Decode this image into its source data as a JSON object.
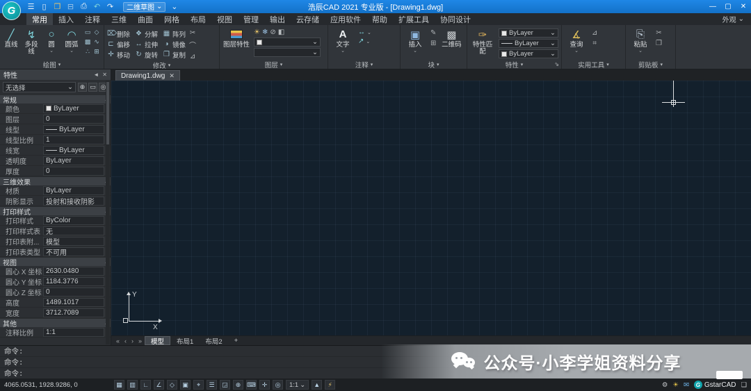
{
  "icons": {
    "menu": "☰",
    "new_file": "▯",
    "open_folder": "❒",
    "save": "⊟",
    "plot": "⎙",
    "undo": "↶",
    "redo": "↷",
    "chev": "▾",
    "chev_sm": "⌄",
    "chev_up": "▴",
    "launcher": "⇘",
    "win_min": "—",
    "win_max": "▢",
    "win_close": "✕",
    "close_sm": "✕",
    "autohide": "◄",
    "line": "╱",
    "polyline": "↯",
    "circle": "○",
    "arc": "◠",
    "rectangle": "▭",
    "polygon": "◇",
    "hatch": "▩",
    "spline": "∿",
    "point": "∴",
    "region": "⊞",
    "erase": "⌦",
    "explode": "❖",
    "array": "▦",
    "offset": "⊏",
    "stretch": "↔",
    "mirror": "◑",
    "move": "✛",
    "rotate": "↻",
    "copy": "❐",
    "trim": "✂",
    "fillet": "⌒",
    "scale": "⊿",
    "layer_on": "☀",
    "layer_freeze": "❄",
    "layer_lock": "⊘",
    "layer_color": "◧",
    "text": "A",
    "dimension": "↔",
    "leader": "↗",
    "insert": "▣",
    "qrcode": "▩",
    "block_edit": "✎",
    "block_create": "⊞",
    "match": "✑",
    "query": "∡",
    "measure": "⊿",
    "calculator": "⌗",
    "paste": "⎘",
    "pickadd": "⊕",
    "select_objects": "▭",
    "quick_select": "◎",
    "grid": "▦",
    "snap": "▥",
    "ortho": "∟",
    "polar": "∠",
    "iso": "◇",
    "osnap": "▣",
    "otrack": "⌖",
    "lwt": "☰",
    "transparency": "◲",
    "cycling": "⊕",
    "dyn": "⌨",
    "pan": "✛",
    "zoom": "◎",
    "anno_vis": "▲",
    "anno_auto": "⚡",
    "gear": "⚙",
    "bulb": "☀",
    "message": "✉",
    "fullscreen": "❏",
    "tab_first": "«",
    "tab_prev": "‹",
    "tab_next": "›",
    "tab_last": "»",
    "tab_add": "+"
  },
  "titlebar": {
    "logo": "G",
    "title": "浩辰CAD 2021 专业版 - [Drawing1.dwg]",
    "workspace": "二维草图"
  },
  "ribbon": {
    "tabs": [
      "常用",
      "插入",
      "注释",
      "三维",
      "曲面",
      "网格",
      "布局",
      "视图",
      "管理",
      "输出",
      "云存储",
      "应用软件",
      "帮助",
      "扩展工具",
      "协同设计"
    ],
    "appearance": "外观",
    "draw": {
      "label": "绘图",
      "b0": "直线",
      "b1": "多段线",
      "b2": "圆",
      "b3": "圆弧"
    },
    "modify": {
      "label": "修改",
      "b0": "删除",
      "b1": "分解",
      "b2": "阵列",
      "b3": "偏移",
      "b4": "拉伸",
      "b5": "镜像",
      "b6": "移动",
      "b7": "旋转",
      "b8": "复制"
    },
    "layer": {
      "label": "图层",
      "b0": "图层特性"
    },
    "annotate": {
      "label": "注释",
      "b0": "文字"
    },
    "block": {
      "label": "块",
      "b0": "插入",
      "b1": "二维码"
    },
    "props": {
      "label": "特性",
      "b0": "特性匹配",
      "d0": "ByLayer",
      "d1": "ByLayer",
      "d2": "ByLayer"
    },
    "util": {
      "label": "实用工具",
      "b0": "查询"
    },
    "clip": {
      "label": "剪贴板",
      "b0": "粘贴"
    }
  },
  "doc_tab": {
    "name": "Drawing1.dwg"
  },
  "palette": {
    "title": "特性",
    "selector": "无选择",
    "s0": {
      "title": "常规",
      "r0": {
        "l": "颜色",
        "v": "ByLayer"
      },
      "r1": {
        "l": "图层",
        "v": "0"
      },
      "r2": {
        "l": "线型",
        "v": "ByLayer"
      },
      "r3": {
        "l": "线型比例",
        "v": "1"
      },
      "r4": {
        "l": "线宽",
        "v": "ByLayer"
      },
      "r5": {
        "l": "透明度",
        "v": "ByLayer"
      },
      "r6": {
        "l": "厚度",
        "v": "0"
      }
    },
    "s1": {
      "title": "三维效果",
      "r0": {
        "l": "材质",
        "v": "ByLayer"
      },
      "r1": {
        "l": "阴影显示",
        "v": "投射和接收阴影"
      }
    },
    "s2": {
      "title": "打印样式",
      "r0": {
        "l": "打印样式",
        "v": "ByColor"
      },
      "r1": {
        "l": "打印样式表",
        "v": "无"
      },
      "r2": {
        "l": "打印表附...",
        "v": "模型"
      },
      "r3": {
        "l": "打印表类型",
        "v": "不可用"
      }
    },
    "s3": {
      "title": "视图",
      "r0": {
        "l": "圆心 X 坐标",
        "v": "2630.0480"
      },
      "r1": {
        "l": "圆心 Y 坐标",
        "v": "1184.3776"
      },
      "r2": {
        "l": "圆心 Z 坐标",
        "v": "0"
      },
      "r3": {
        "l": "高度",
        "v": "1489.1017"
      },
      "r4": {
        "l": "宽度",
        "v": "3712.7089"
      }
    },
    "s4": {
      "title": "其他",
      "r0": {
        "l": "注释比例",
        "v": "1:1"
      }
    }
  },
  "ucs": {
    "x": "X",
    "y": "Y"
  },
  "layout": {
    "t0": "模型",
    "t1": "布局1",
    "t2": "布局2"
  },
  "command": {
    "l0": "命令:",
    "l1": "命令:",
    "l2": "命令:"
  },
  "status": {
    "coords": "4065.0531, 1928.9286, 0",
    "scale": "1:1",
    "brand": "GstarCAD"
  },
  "watermark": {
    "text": "公众号·小李学姐资料分享"
  }
}
